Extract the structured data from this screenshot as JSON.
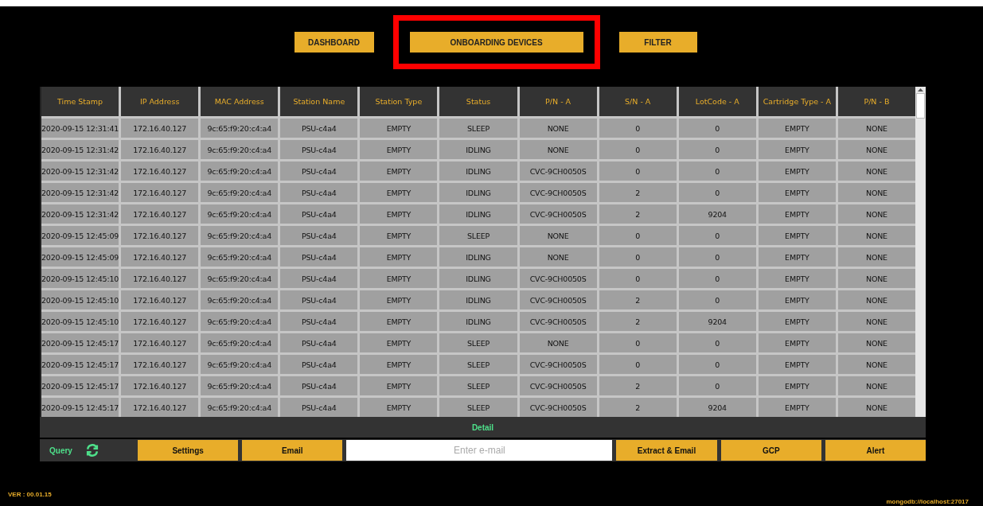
{
  "nav": [
    {
      "label": "DASHBOARD",
      "selected": false
    },
    {
      "label": "ONBOARDING DEVICES",
      "selected": true
    },
    {
      "label": "FILTER",
      "selected": false
    }
  ],
  "table": {
    "columns": [
      "Time Stamp",
      "IP Address",
      "MAC Address",
      "Station Name",
      "Station Type",
      "Status",
      "P/N - A",
      "S/N - A",
      "LotCode - A",
      "Cartridge Type - A",
      "P/N - B"
    ],
    "rows": [
      [
        "2020-09-15 12:31:41",
        "172.16.40.127",
        "9c:65:f9:20:c4:a4",
        "PSU-c4a4",
        "EMPTY",
        "SLEEP",
        "NONE",
        "0",
        "0",
        "EMPTY",
        "NONE"
      ],
      [
        "2020-09-15 12:31:42",
        "172.16.40.127",
        "9c:65:f9:20:c4:a4",
        "PSU-c4a4",
        "EMPTY",
        "IDLING",
        "NONE",
        "0",
        "0",
        "EMPTY",
        "NONE"
      ],
      [
        "2020-09-15 12:31:42",
        "172.16.40.127",
        "9c:65:f9:20:c4:a4",
        "PSU-c4a4",
        "EMPTY",
        "IDLING",
        "CVC-9CH0050S",
        "0",
        "0",
        "EMPTY",
        "NONE"
      ],
      [
        "2020-09-15 12:31:42",
        "172.16.40.127",
        "9c:65:f9:20:c4:a4",
        "PSU-c4a4",
        "EMPTY",
        "IDLING",
        "CVC-9CH0050S",
        "2",
        "0",
        "EMPTY",
        "NONE"
      ],
      [
        "2020-09-15 12:31:42",
        "172.16.40.127",
        "9c:65:f9:20:c4:a4",
        "PSU-c4a4",
        "EMPTY",
        "IDLING",
        "CVC-9CH0050S",
        "2",
        "9204",
        "EMPTY",
        "NONE"
      ],
      [
        "2020-09-15 12:45:09",
        "172.16.40.127",
        "9c:65:f9:20:c4:a4",
        "PSU-c4a4",
        "EMPTY",
        "SLEEP",
        "NONE",
        "0",
        "0",
        "EMPTY",
        "NONE"
      ],
      [
        "2020-09-15 12:45:09",
        "172.16.40.127",
        "9c:65:f9:20:c4:a4",
        "PSU-c4a4",
        "EMPTY",
        "IDLING",
        "NONE",
        "0",
        "0",
        "EMPTY",
        "NONE"
      ],
      [
        "2020-09-15 12:45:10",
        "172.16.40.127",
        "9c:65:f9:20:c4:a4",
        "PSU-c4a4",
        "EMPTY",
        "IDLING",
        "CVC-9CH0050S",
        "0",
        "0",
        "EMPTY",
        "NONE"
      ],
      [
        "2020-09-15 12:45:10",
        "172.16.40.127",
        "9c:65:f9:20:c4:a4",
        "PSU-c4a4",
        "EMPTY",
        "IDLING",
        "CVC-9CH0050S",
        "2",
        "0",
        "EMPTY",
        "NONE"
      ],
      [
        "2020-09-15 12:45:10",
        "172.16.40.127",
        "9c:65:f9:20:c4:a4",
        "PSU-c4a4",
        "EMPTY",
        "IDLING",
        "CVC-9CH0050S",
        "2",
        "9204",
        "EMPTY",
        "NONE"
      ],
      [
        "2020-09-15 12:45:17",
        "172.16.40.127",
        "9c:65:f9:20:c4:a4",
        "PSU-c4a4",
        "EMPTY",
        "SLEEP",
        "NONE",
        "0",
        "0",
        "EMPTY",
        "NONE"
      ],
      [
        "2020-09-15 12:45:17",
        "172.16.40.127",
        "9c:65:f9:20:c4:a4",
        "PSU-c4a4",
        "EMPTY",
        "SLEEP",
        "CVC-9CH0050S",
        "0",
        "0",
        "EMPTY",
        "NONE"
      ],
      [
        "2020-09-15 12:45:17",
        "172.16.40.127",
        "9c:65:f9:20:c4:a4",
        "PSU-c4a4",
        "EMPTY",
        "SLEEP",
        "CVC-9CH0050S",
        "2",
        "0",
        "EMPTY",
        "NONE"
      ],
      [
        "2020-09-15 12:45:17",
        "172.16.40.127",
        "9c:65:f9:20:c4:a4",
        "PSU-c4a4",
        "EMPTY",
        "SLEEP",
        "CVC-9CH0050S",
        "2",
        "9204",
        "EMPTY",
        "NONE"
      ]
    ]
  },
  "detail": "Detail",
  "toolbar": {
    "query": "Query",
    "buttons_left": [
      "Settings",
      "Email"
    ],
    "email": {
      "placeholder": "Enter e-mail"
    },
    "buttons_right": [
      "Extract & Email",
      "GCP",
      "Alert"
    ]
  },
  "version": "VER : 00.01.15",
  "connection": "mongodb://localhost:27017"
}
